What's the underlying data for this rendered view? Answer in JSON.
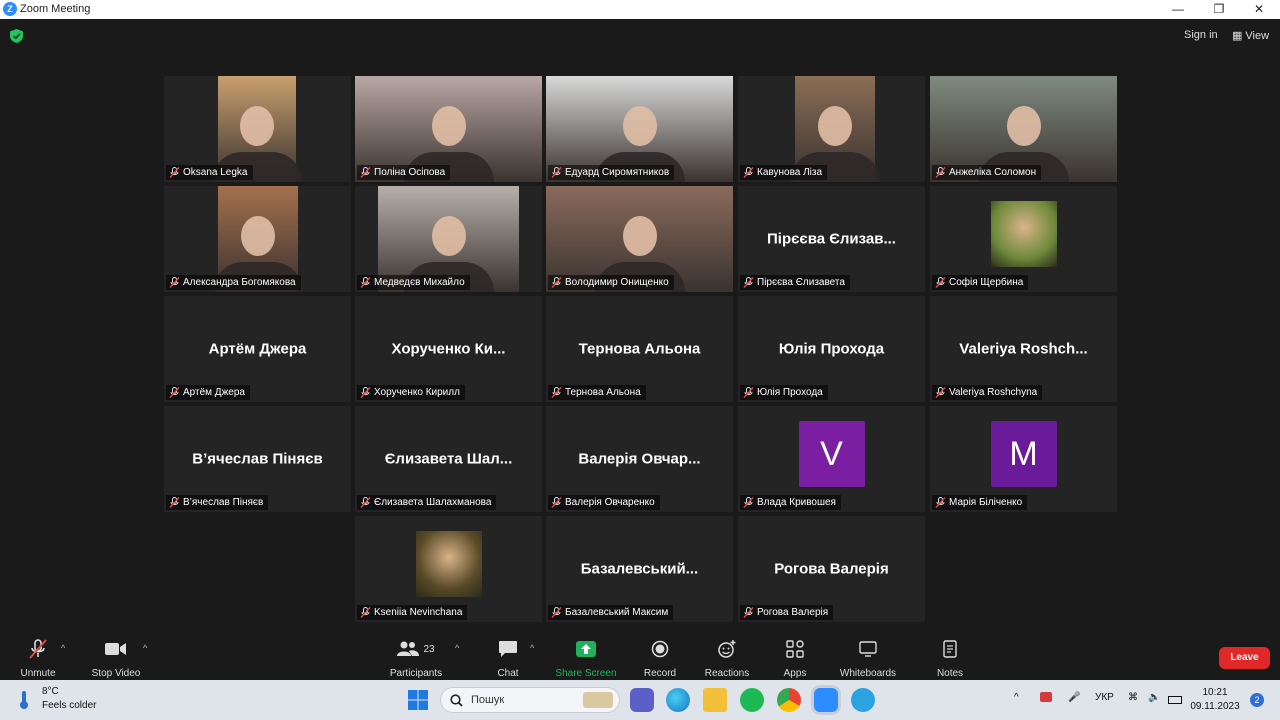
{
  "window": {
    "title": "Zoom Meeting",
    "minimize": "—",
    "maximize": "❐",
    "close": "✕"
  },
  "topbar": {
    "signin": "Sign in",
    "view": "View"
  },
  "participants": [
    {
      "name": "Oksana Legka",
      "kind": "video",
      "bg": "#c9a06f"
    },
    {
      "name": "Поліна Осіпова",
      "kind": "video",
      "bg": "#b9a7a4"
    },
    {
      "name": "Едуард Сиромятников",
      "kind": "video",
      "bg": "#d9d9d9",
      "active": true
    },
    {
      "name": "Кавунова Ліза",
      "kind": "video",
      "bg": "#8a6e55"
    },
    {
      "name": "Анжеліка Соломон",
      "kind": "video",
      "bg": "#7f8b80"
    },
    {
      "name": "Александра Богомякова",
      "kind": "video",
      "bg": "#a5704d"
    },
    {
      "name": "Медведєв Михайло",
      "kind": "video",
      "bg": "#b7b0aa"
    },
    {
      "name": "Володимир Онищенко",
      "kind": "video",
      "bg": "#8a6b5c"
    },
    {
      "name": "Пірєєва Єлизавета",
      "display": "Пірєєва Єлизав...",
      "kind": "name"
    },
    {
      "name": "Софія Щербина",
      "kind": "photo",
      "bg": "#6e8a3a"
    },
    {
      "name": "Артём Джера",
      "display": "Артём Джера",
      "kind": "name"
    },
    {
      "name": "Хорученко Кирилл",
      "display": "Хорученко Ки...",
      "kind": "name"
    },
    {
      "name": "Тернова Альона",
      "display": "Тернова Альона",
      "kind": "name"
    },
    {
      "name": "Юлія Прохода",
      "display": "Юлія Прохода",
      "kind": "name"
    },
    {
      "name": "Valeriya Roshchyna",
      "display": "Valeriya Roshch...",
      "kind": "name"
    },
    {
      "name": "В’ячеслав Піняєв",
      "display": "В’ячеслав Піняєв",
      "kind": "name"
    },
    {
      "name": "Єлизавета Шалахманова",
      "display": "Єлизавета Шал...",
      "kind": "name"
    },
    {
      "name": "Валерія Овчаренко",
      "display": "Валерія Овчар...",
      "kind": "name"
    },
    {
      "name": "Влада Кривошея",
      "kind": "avatar",
      "letter": "V",
      "bg": "#7b1fa2"
    },
    {
      "name": "Марія Біліченко",
      "kind": "avatar",
      "letter": "M",
      "bg": "#6a1b9a"
    },
    {
      "name": "Kseniia Nevinchana",
      "kind": "photo",
      "bg": "#5a4a28"
    },
    {
      "name": "Базалевський Максим",
      "display": "Базалевський...",
      "kind": "name"
    },
    {
      "name": "Рогова Валерія",
      "display": "Рогова Валерія",
      "kind": "name"
    }
  ],
  "toolbar": {
    "unmute": "Unmute",
    "stop_video": "Stop Video",
    "participants": "Participants",
    "participant_count": "23",
    "chat": "Chat",
    "share_screen": "Share Screen",
    "record": "Record",
    "reactions": "Reactions",
    "apps": "Apps",
    "whiteboards": "Whiteboards",
    "notes": "Notes",
    "leave": "Leave"
  },
  "taskbar": {
    "temperature": "8°C",
    "weather_text": "Feels colder",
    "search_placeholder": "Пошук",
    "language": "УКР",
    "time": "10:21",
    "date": "09.11.2023",
    "notifications": "2"
  },
  "colors": {
    "accent_active": "#a8e05a",
    "leave": "#e02828",
    "share": "#20b25a",
    "muted_mic": "#e04848"
  }
}
